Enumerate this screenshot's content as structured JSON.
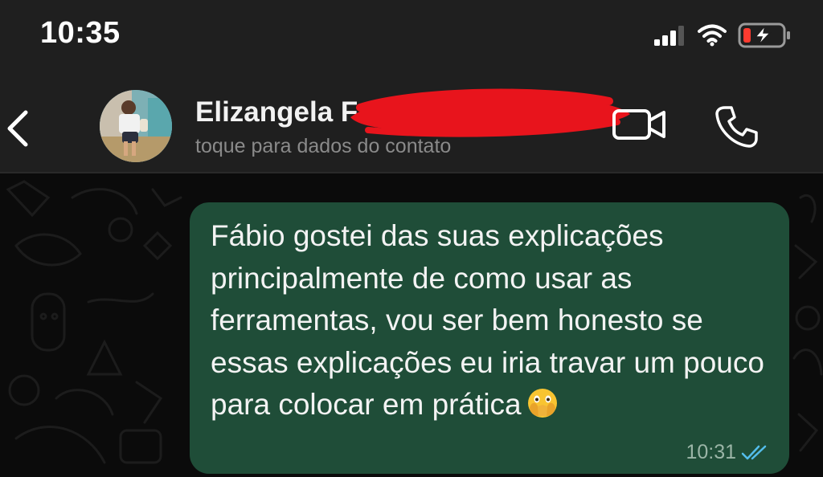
{
  "status_bar": {
    "time": "10:35",
    "signal_icon": "cellular-signal-icon",
    "wifi_icon": "wifi-icon",
    "battery_icon": "battery-charging-low-icon"
  },
  "header": {
    "back_icon": "chevron-left-icon",
    "contact_name": "Elizangela F",
    "subtitle": "toque para dados do contato",
    "video_icon": "video-camera-icon",
    "call_icon": "phone-icon"
  },
  "message": {
    "text": "Fábio gostei das suas explicações principalmente de como usar as ferramentas, vou ser bem honesto se essas explicações eu iria travar um pouco para colocar em prática",
    "emoji_icon": "face-with-open-eyes-and-hand-over-mouth-emoji",
    "time": "10:31",
    "status_icon": "double-check-read-icon"
  },
  "colors": {
    "bubble": "#1f4d38",
    "header": "#1f1f1f",
    "background": "#0b0b0b",
    "read_ticks": "#53bdeb",
    "redaction": "#e8141c"
  }
}
